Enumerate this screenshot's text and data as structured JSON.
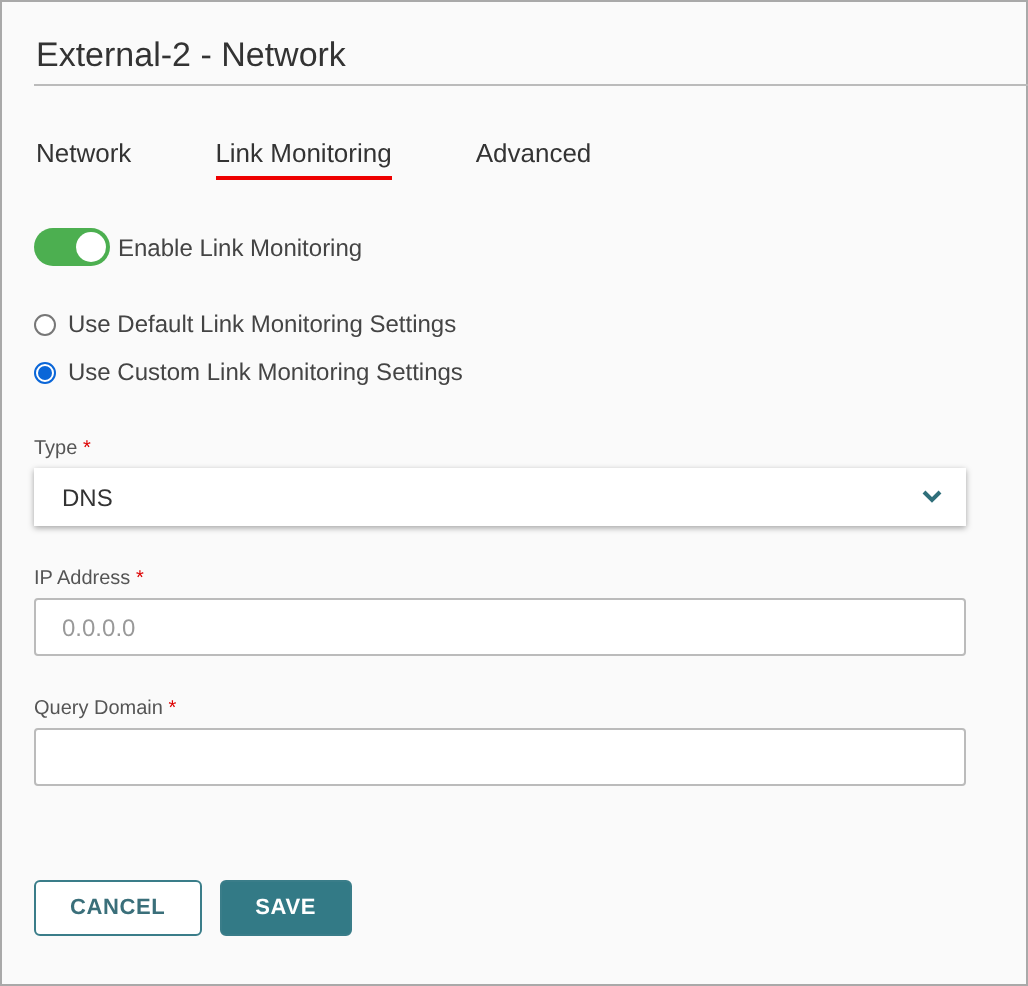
{
  "title": "External-2 - Network",
  "tabs": [
    {
      "label": "Network",
      "selected": false
    },
    {
      "label": "Link Monitoring",
      "selected": true
    },
    {
      "label": "Advanced",
      "selected": false
    }
  ],
  "toggle": {
    "label": "Enable Link Monitoring",
    "on": true
  },
  "radios": [
    {
      "label": "Use Default Link Monitoring Settings",
      "selected": false
    },
    {
      "label": "Use Custom Link Monitoring Settings",
      "selected": true
    }
  ],
  "fields": [
    {
      "kind": "select",
      "label": "Type",
      "required_mark": "*",
      "value": "DNS"
    },
    {
      "kind": "input",
      "label": "IP Address",
      "required_mark": "*",
      "placeholder": "0.0.0.0"
    },
    {
      "kind": "input",
      "label": "Query Domain",
      "required_mark": "*"
    }
  ],
  "buttons": [
    {
      "label": "CANCEL",
      "kind": "secondary"
    },
    {
      "label": "SAVE",
      "kind": "primary"
    }
  ]
}
